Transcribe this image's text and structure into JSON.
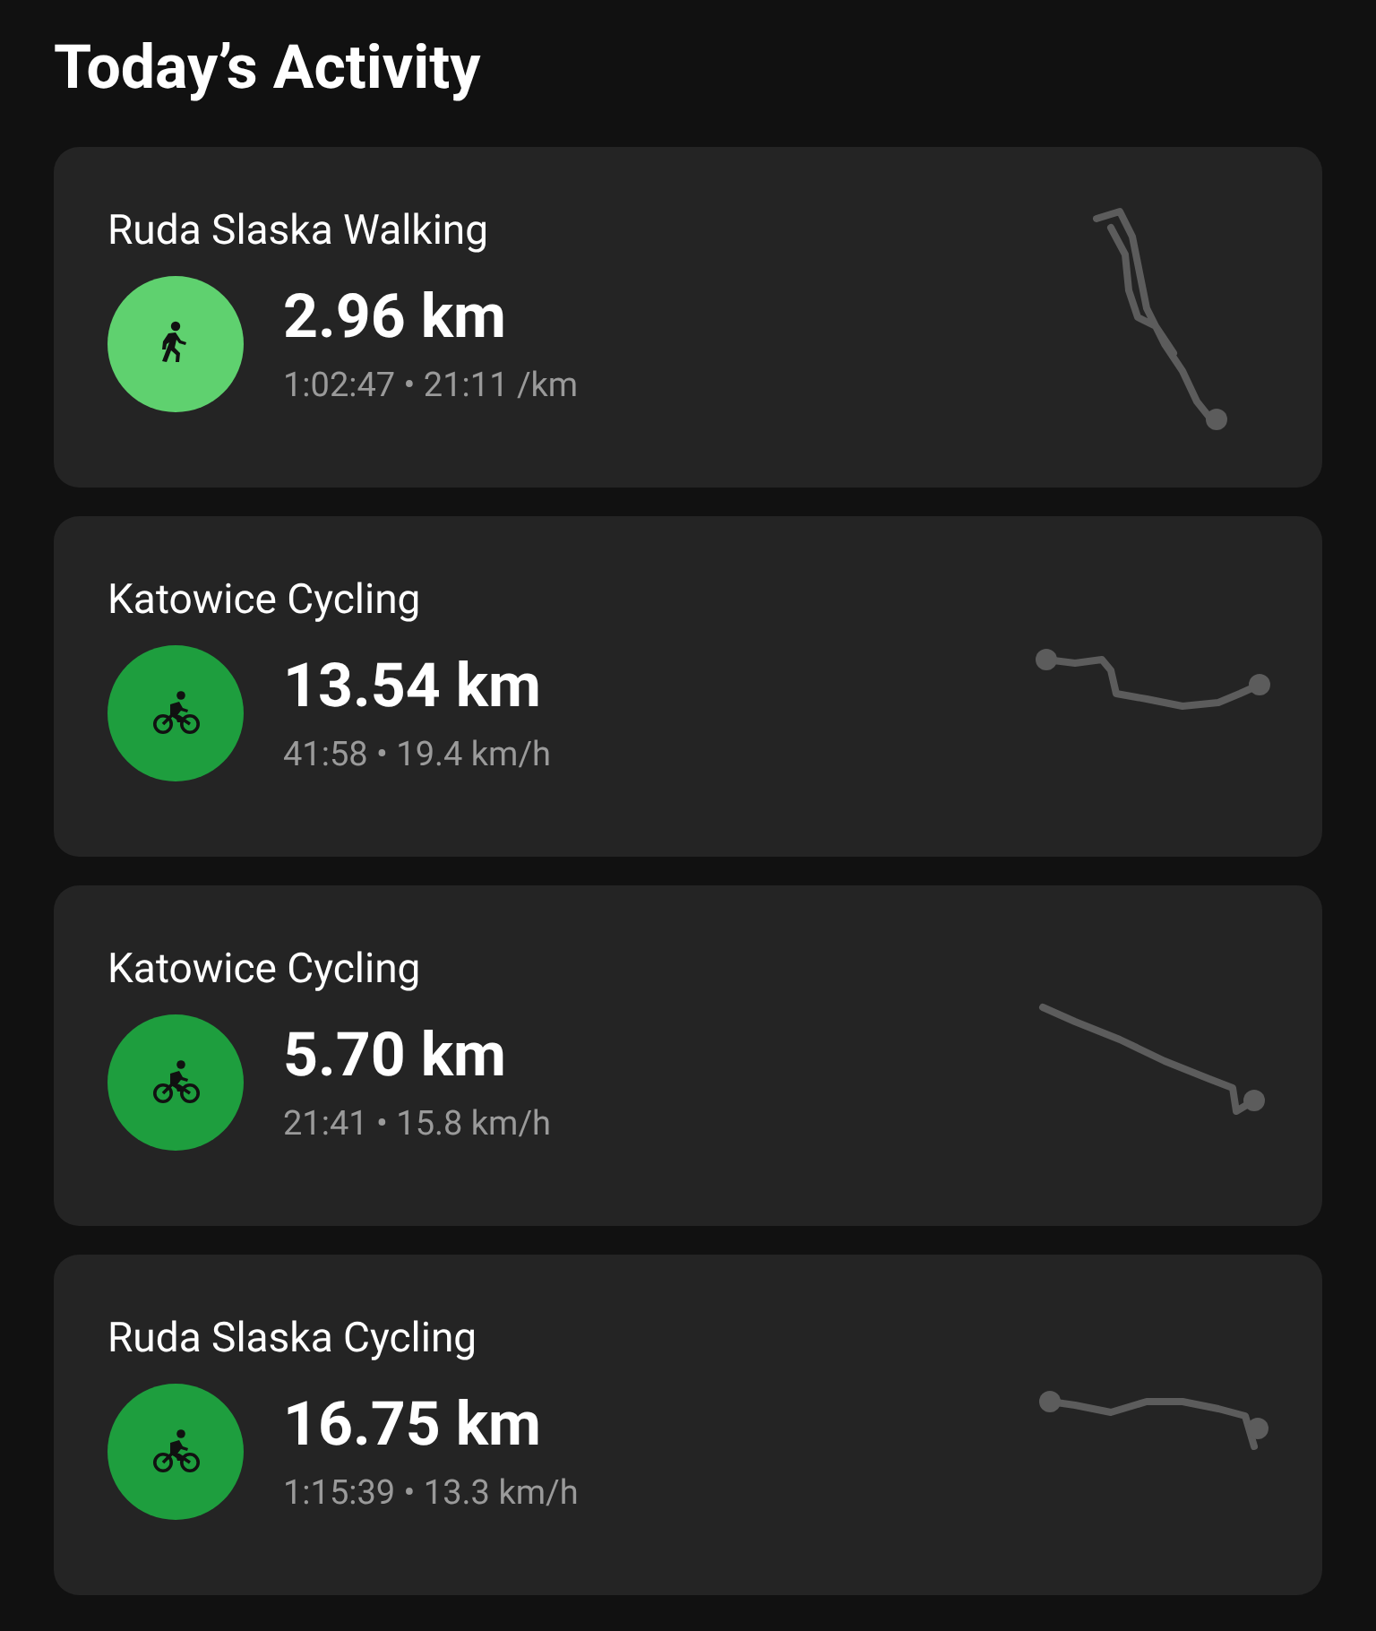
{
  "title": "Today’s Activity",
  "activities": [
    {
      "name": "Ruda Slaska Walking",
      "kind": "walking",
      "distance": "2.96 km",
      "details": "1:02:47 • 21:11 /km"
    },
    {
      "name": "Katowice Cycling",
      "kind": "cycling",
      "distance": "13.54 km",
      "details": "41:58 • 19.4 km/h"
    },
    {
      "name": "Katowice Cycling",
      "kind": "cycling",
      "distance": "5.70 km",
      "details": "21:41 • 15.8 km/h"
    },
    {
      "name": "Ruda Slaska Cycling",
      "kind": "cycling",
      "distance": "16.75 km",
      "details": "1:15:39 • 13.3 km/h"
    }
  ]
}
